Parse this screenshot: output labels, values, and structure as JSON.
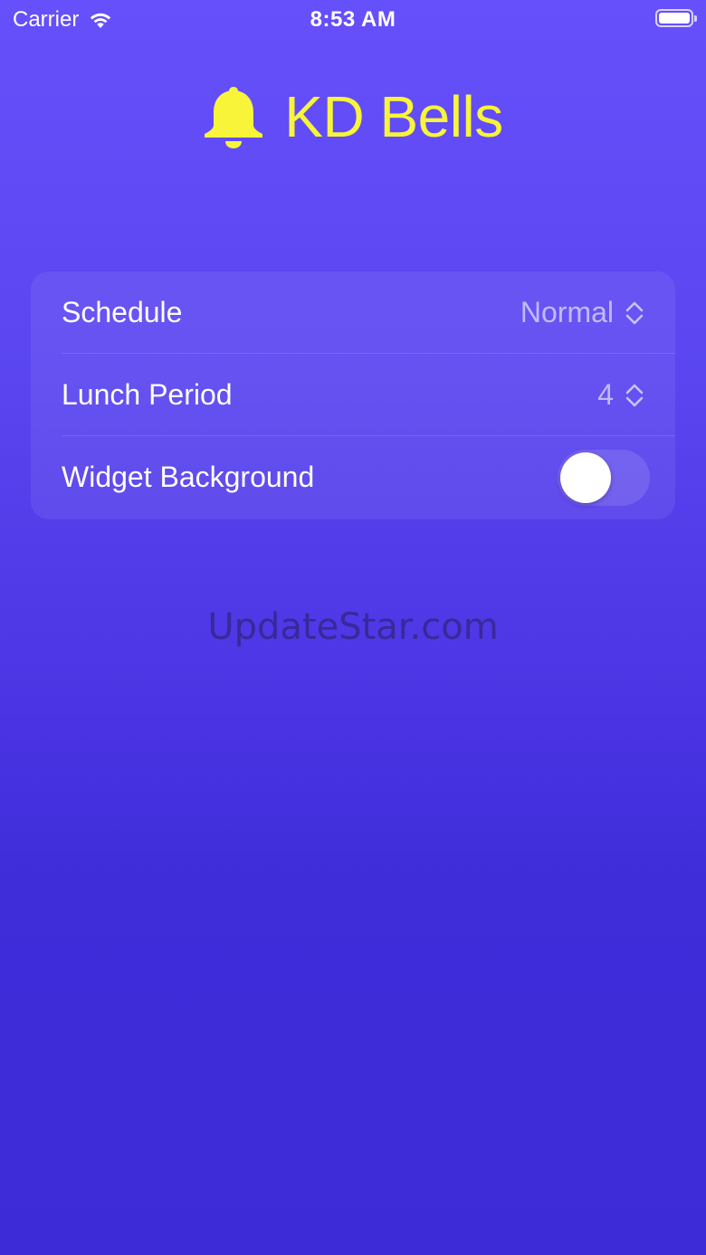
{
  "status_bar": {
    "carrier": "Carrier",
    "time": "8:53 AM",
    "wifi_icon": "wifi-icon",
    "battery_icon": "battery-icon"
  },
  "header": {
    "title": "KD Bells",
    "icon": "bell-icon",
    "title_color": "#f7f43a"
  },
  "settings": {
    "rows": [
      {
        "label": "Schedule",
        "value": "Normal",
        "control": "picker"
      },
      {
        "label": "Lunch Period",
        "value": "4",
        "control": "picker"
      },
      {
        "label": "Widget Background",
        "control": "toggle",
        "on": false
      }
    ]
  },
  "watermark": "UpdateStar.com",
  "colors": {
    "background_top": "#6650fb",
    "background_bottom": "#3d2bd8",
    "accent": "#f7f43a"
  }
}
